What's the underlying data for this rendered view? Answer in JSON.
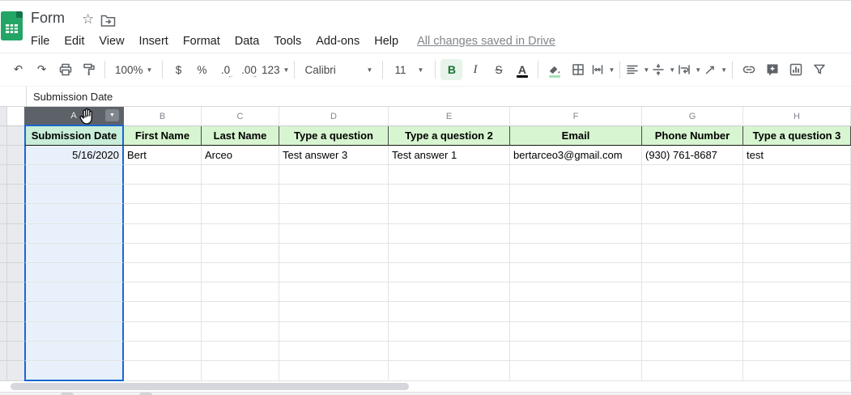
{
  "titlebar": {
    "title": "Form",
    "star_icon": "star-outline",
    "move_icon": "move-to-folder"
  },
  "menu": {
    "items": [
      "File",
      "Edit",
      "View",
      "Insert",
      "Format",
      "Data",
      "Tools",
      "Add-ons",
      "Help"
    ],
    "status": "All changes saved in Drive"
  },
  "toolbar": {
    "groups": [
      [
        {
          "name": "undo",
          "glyph": "↶"
        },
        {
          "name": "redo",
          "glyph": "↷"
        },
        {
          "name": "print",
          "icon": "print"
        },
        {
          "name": "paint-format",
          "icon": "paint"
        }
      ],
      [
        {
          "name": "zoom",
          "label": "100%",
          "dropdown": true,
          "cls": "zoomsel"
        }
      ],
      [
        {
          "name": "format-as-currency",
          "glyph": "$"
        },
        {
          "name": "format-as-percent",
          "glyph": "%"
        },
        {
          "name": "decrease-decimal-places",
          "glyph": ".0",
          "sub": "←"
        },
        {
          "name": "increase-decimal-places",
          "glyph": ".00",
          "sub": "→"
        },
        {
          "name": "more-formats",
          "glyph": "123",
          "dropdown": true
        }
      ],
      [
        {
          "name": "font-family",
          "label": "Calibri",
          "dropdown": true,
          "cls": "fontname"
        }
      ],
      [
        {
          "name": "font-size",
          "label": "11",
          "dropdown": true,
          "cls": "fontsize"
        }
      ],
      [
        {
          "name": "bold",
          "glyph": "B",
          "gcls": "g-bold",
          "active": true
        },
        {
          "name": "italic",
          "glyph": "I",
          "gcls": "g-italic"
        },
        {
          "name": "strikethrough",
          "glyph": "S",
          "gcls": "g-strike"
        },
        {
          "name": "text-color",
          "glyph": "A",
          "gcls": "g-bold",
          "bar": "#000000"
        }
      ],
      [
        {
          "name": "fill-color",
          "icon": "fill",
          "bar": "#a7e2b8"
        },
        {
          "name": "borders",
          "icon": "borders"
        },
        {
          "name": "merge-cells",
          "icon": "merge",
          "dropdown": true
        }
      ],
      [
        {
          "name": "horizontal-align",
          "icon": "alignleft",
          "dropdown": true
        },
        {
          "name": "vertical-align",
          "icon": "valign",
          "dropdown": true
        },
        {
          "name": "text-wrapping",
          "icon": "wrap",
          "dropdown": true
        },
        {
          "name": "text-rotation",
          "icon": "rotate",
          "dropdown": true
        }
      ],
      [
        {
          "name": "insert-link",
          "icon": "link"
        },
        {
          "name": "insert-comment",
          "icon": "comment"
        },
        {
          "name": "insert-chart",
          "icon": "chart"
        },
        {
          "name": "create-filter",
          "icon": "filter"
        }
      ]
    ]
  },
  "formula_bar": {
    "value": "Submission Date"
  },
  "grid": {
    "columns": [
      "A",
      "B",
      "C",
      "D",
      "E",
      "F",
      "G",
      "H"
    ],
    "selected_column": "A",
    "header_row": [
      "Submission Date",
      "First Name",
      "Last Name",
      "Type a question",
      "Type a question 2",
      "Email",
      "Phone Number",
      "Type a question 3"
    ],
    "data_row": [
      "5/16/2020",
      "Bert",
      "Arceo",
      "Test answer 3",
      "Test answer 1",
      "bertarceo3@gmail.com",
      "(930) 761-8687",
      "test"
    ],
    "empty_row_count": 11
  },
  "colors": {
    "header_fill": "#d7f5d0",
    "selected_header_fill": "#c8edd8",
    "selection_blue": "#1967d2",
    "selected_column_fill": "#e8f1fb",
    "sheets_green": "#23a566",
    "column_head_selected": "#5d6269"
  }
}
